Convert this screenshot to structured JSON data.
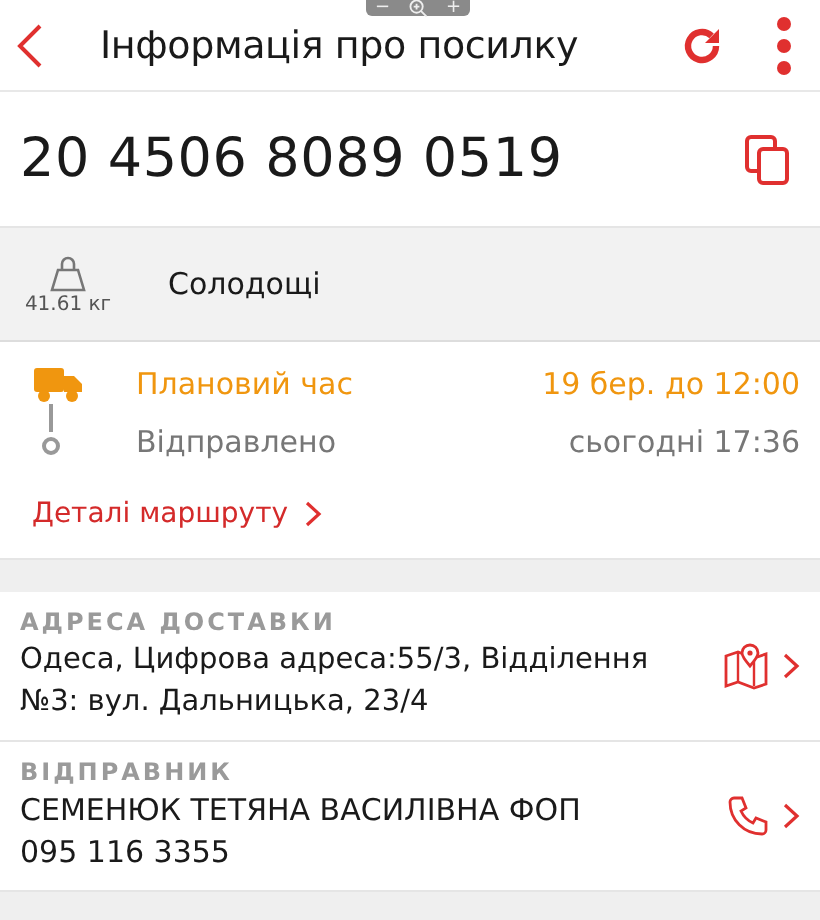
{
  "header": {
    "title": "Інформація про посилку"
  },
  "zoom_control": {
    "minus": "−",
    "plus": "+"
  },
  "tracking_number": "20 4506 8089 0519",
  "parcel": {
    "weight": "41.61 кг",
    "description": "Солодощі"
  },
  "statuses": [
    {
      "kind": "planned",
      "label": "Плановий час",
      "time": "19 бер. до 12:00"
    },
    {
      "kind": "sent",
      "label": "Відправлено",
      "time": "сьогодні 17:36"
    }
  ],
  "route_link": "Деталі маршруту",
  "sections": [
    {
      "kind": "address",
      "heading": "АДРЕСА ДОСТАВКИ",
      "lines": [
        "Одеса, Цифрова адреса:55/3, Відділення №3: вул. Дальницька, 23/4"
      ]
    },
    {
      "kind": "sender",
      "heading": "ВІДПРАВНИК",
      "lines": [
        "СЕМЕНЮК ТЕТЯНА ВАСИЛІВНА ФОП",
        "095 116 3355"
      ]
    }
  ]
}
